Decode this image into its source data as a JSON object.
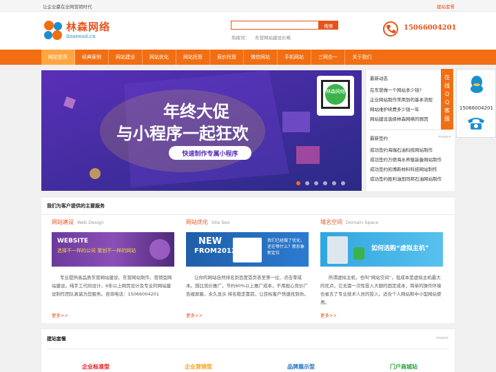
{
  "topbar": {
    "slogan": "让企业赢在全网营销时代",
    "package_link": "建站套餐"
  },
  "logo": {
    "name": "林森网络",
    "domain": "linsensd.cn"
  },
  "search": {
    "placeholder": "",
    "button": "搜索",
    "hot_label": "热搜词：",
    "hot_word": "东营网站建设价格"
  },
  "phone": "15066004201",
  "nav": [
    "网站首页",
    "经典案例",
    "网站建设",
    "网站优化",
    "网站托管",
    "竞价托管",
    "微信网站",
    "手机网站",
    "三网合一",
    "关于我们"
  ],
  "banner": {
    "line1": "年终大促",
    "line2": "与小程序一起狂欢",
    "cta": "快速制作专属小程序",
    "qr_badge": "林森网络",
    "slides": 6,
    "active_slide": 1
  },
  "news": {
    "title": "最新动态",
    "items": [
      "在东营做一个网站多少钱?",
      "企业网站制作常用到的基本流程",
      "网站维护续费多少钱一年",
      "网站建设选择林森网络的原因"
    ]
  },
  "signed": {
    "title": "最新签约",
    "more": "more+",
    "items": [
      "成功签约海瑞石油科技网站制作",
      "成功签约万德海水养殖装备网站制作",
      "成功签约凯博新材料科技网站制作",
      "成功签约胜利油田同邦石油网站制作"
    ]
  },
  "float": {
    "qq_label": "在线QQ客服",
    "phone": "15066004201"
  },
  "services": {
    "title": "我们为客户提供的主要服务",
    "items": [
      {
        "title": "网站建设",
        "subtitle": "Web Design",
        "img_big": "WEBSITE",
        "img_line": "选择不一样的公司  策划不一样的网站",
        "desc": "专业提供高品质东营网站建设、东营网站制作、营销型网站建设。纯手工代码设计，6年以上网页设计及专业的网站建设制作团队真诚为您服务。咨询电话：15066004201",
        "more": "更多>>"
      },
      {
        "title": "网站优化",
        "subtitle": "Site Seo",
        "img_big": "NEW",
        "img_sub": "FROM2012",
        "img_line": "我们已经做了优化，还在等什么？新形象 新定位",
        "desc": "让你的网站自然排名到百度首页甚至第一位、点击零成本。想比竞价推广，节约60%以上推广成本，不用担心竞价广告被屏蔽，永久显示 排名稳定靠前，让目标客户快速找到你。",
        "more": "更多>>"
      },
      {
        "title": "域名空间",
        "subtitle": "Domain Space",
        "img_line": "如何选购“虚拟主机”",
        "desc": "所谓虚拟主机，也叫“网站空间”，低成本是虚拟主机最大的优点，它无需一次性投入大额的固定成本，简单的操作环境也省去了专业技术人员的投入，适合个人网站和中小型网站使用。",
        "more": "更多>>"
      }
    ]
  },
  "packages": {
    "title": "建站套餐",
    "more": "more+",
    "items": [
      {
        "name": "企业标准型",
        "color": "#e8191f"
      },
      {
        "name": "企业营销型",
        "color": "#f5a31a"
      },
      {
        "name": "品牌展示型",
        "color": "#1f6fc4"
      },
      {
        "name": "门户商城站",
        "color": "#2aa33b"
      }
    ]
  },
  "colors": {
    "accent": "#f16e12",
    "brand": "#e8531b"
  }
}
